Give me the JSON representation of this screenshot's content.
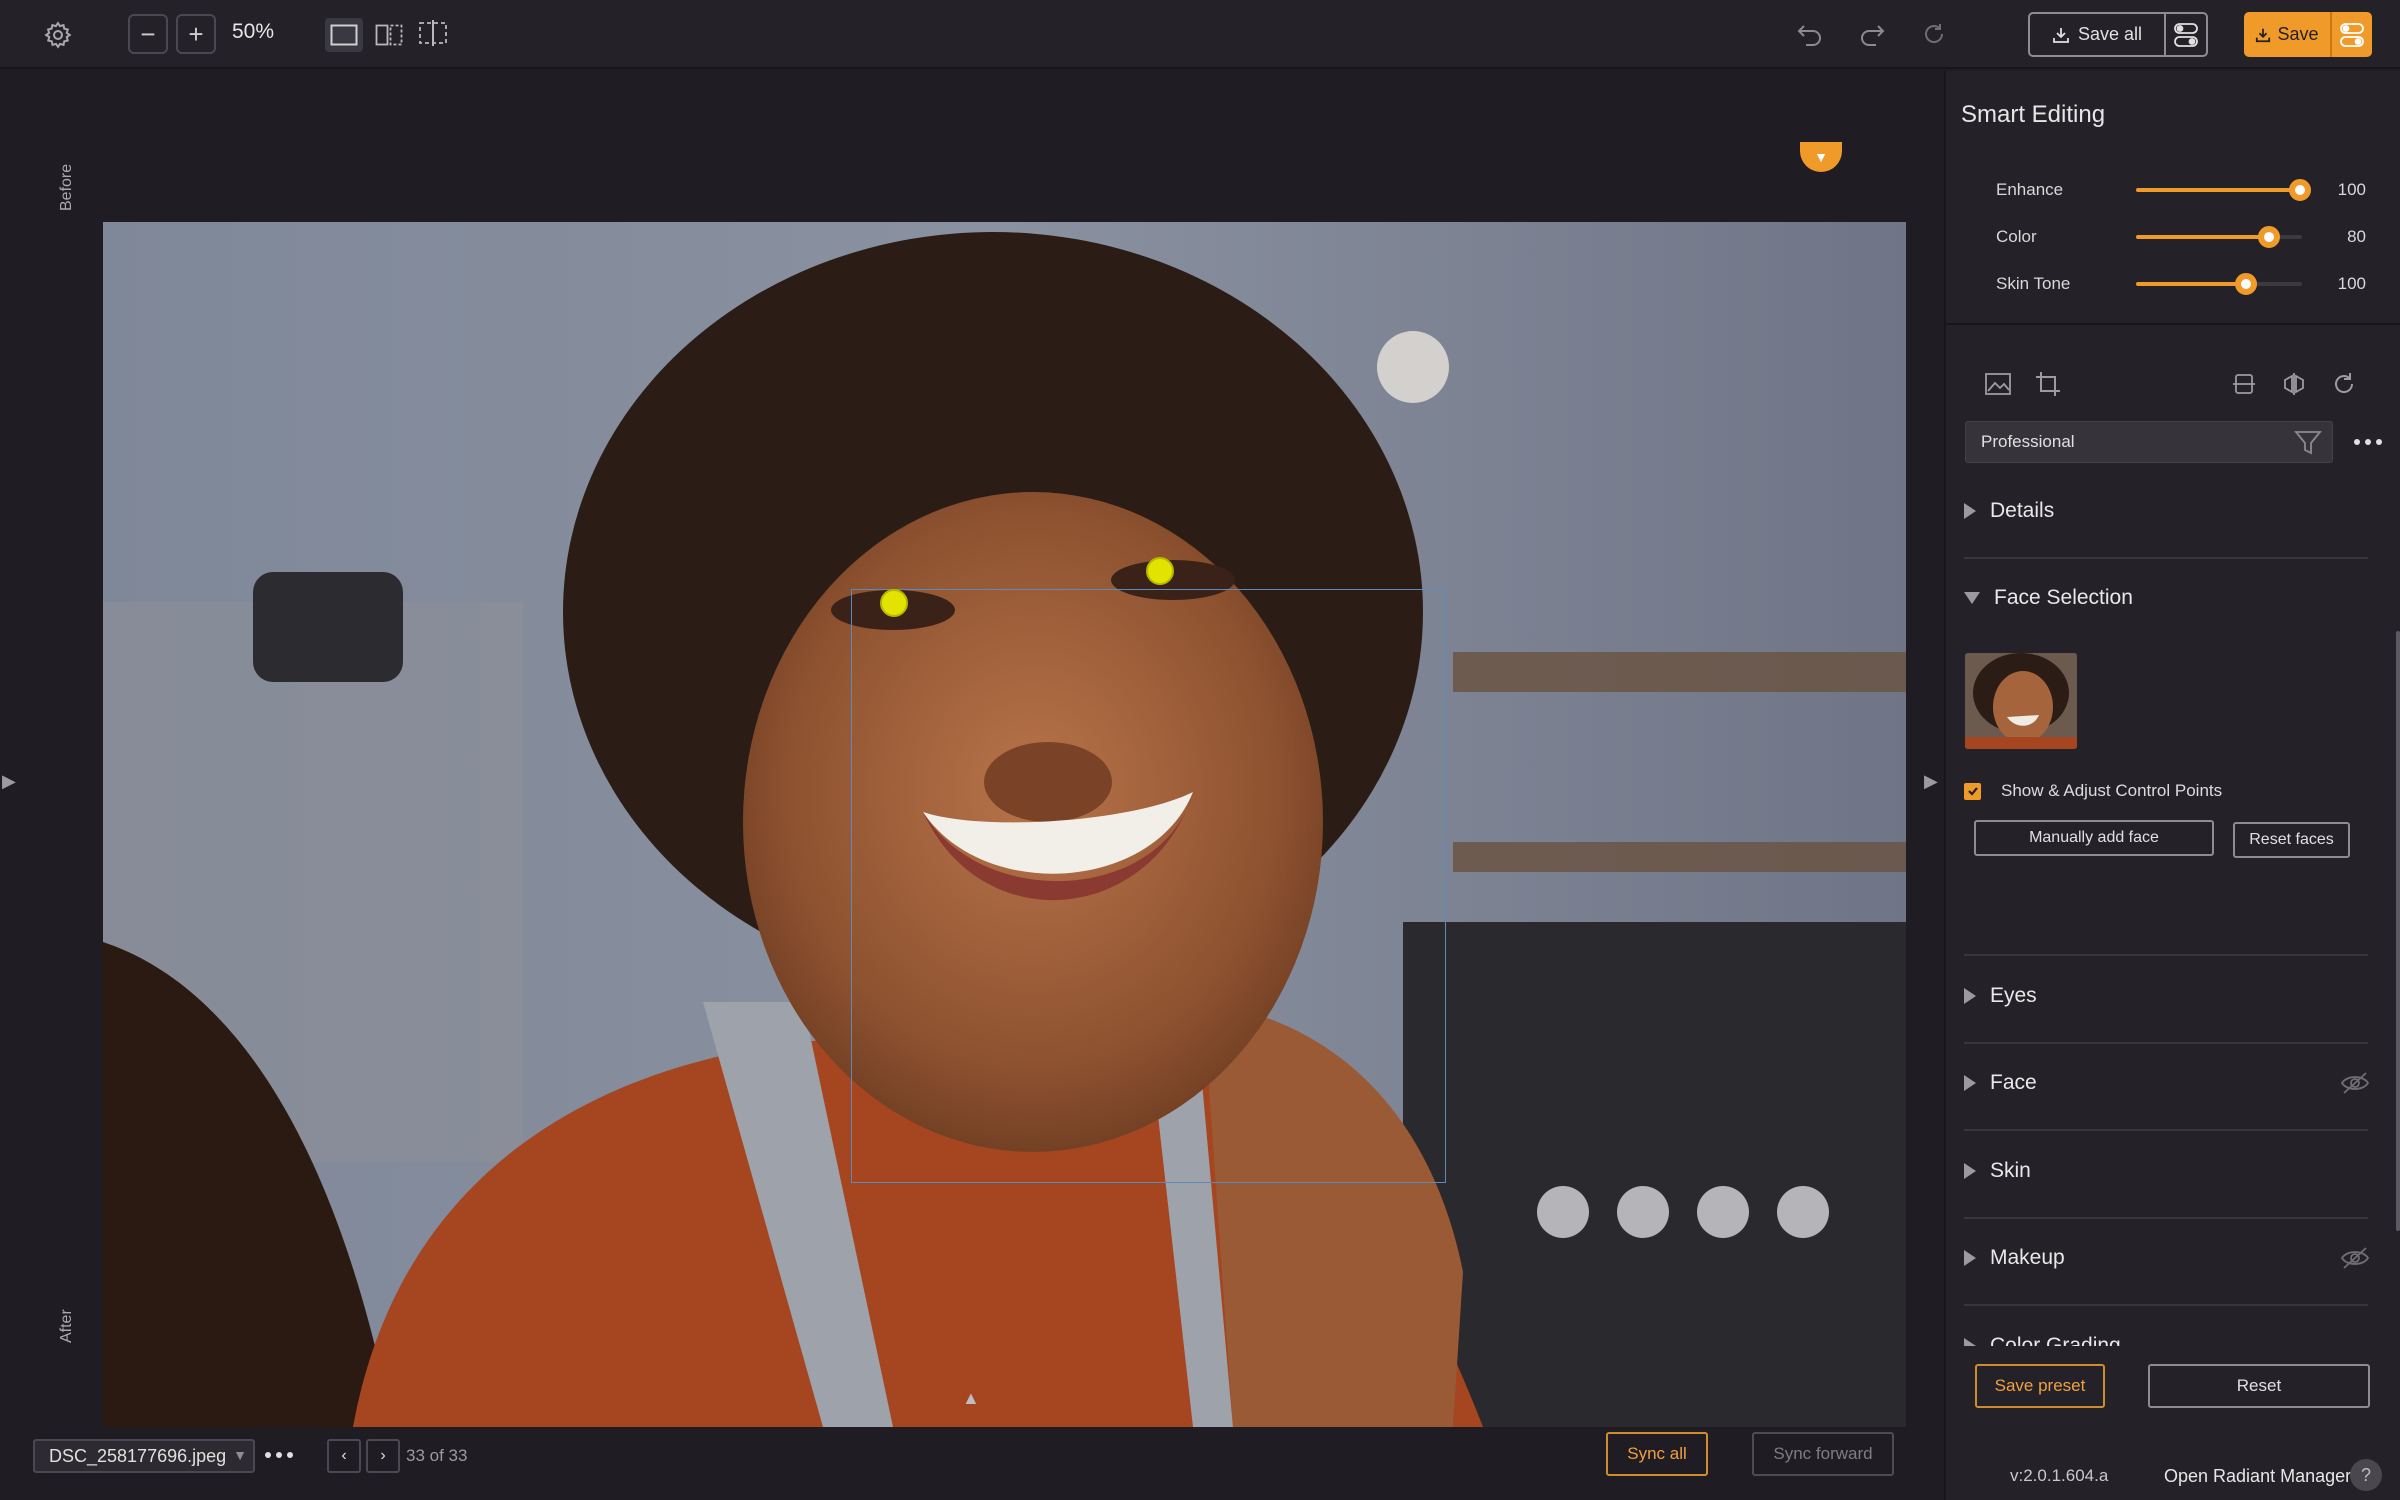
{
  "toolbar": {
    "zoom_out_label": "−",
    "zoom_in_label": "+",
    "zoom_value": "50%",
    "save_all_label": "Save all",
    "save_label": "Save"
  },
  "canvas": {
    "before_label": "Before",
    "after_label": "After"
  },
  "bottombar": {
    "file_name": "DSC_258177696.jpeg",
    "counter": "33 of 33",
    "sync_all_label": "Sync all",
    "sync_forward_label": "Sync forward"
  },
  "panel": {
    "title": "Smart Editing",
    "sliders": [
      {
        "label": "Enhance",
        "value": "100",
        "level": 0.99
      },
      {
        "label": "Color",
        "value": "80",
        "level": 0.8
      },
      {
        "label": "Skin Tone",
        "value": "100",
        "level": 0.66
      }
    ],
    "preset_value": "Professional",
    "sections": {
      "details": "Details",
      "face_selection": "Face Selection",
      "eyes": "Eyes",
      "face": "Face",
      "skin": "Skin",
      "makeup": "Makeup",
      "color_grading": "Color Grading"
    },
    "show_control_points_label": "Show & Adjust Control Points",
    "show_control_points_checked": true,
    "manually_add_face_label": "Manually add face",
    "reset_faces_label": "Reset faces",
    "save_preset_label": "Save preset",
    "reset_label": "Reset",
    "version": "v:2.0.1.604.a",
    "manager_label": "Open Radiant Manager",
    "help_label": "?"
  },
  "colors": {
    "accent": "#f09a2a",
    "background": "#1f1d23",
    "panel": "#242228",
    "control_point": "#e3e300",
    "face_box": "#5f89b8"
  },
  "icons": [
    "gear-icon",
    "undo-icon",
    "redo-icon",
    "refresh-icon",
    "download-icon",
    "toggle-icon",
    "image-icon",
    "crop-icon",
    "straighten-icon",
    "flip-icon",
    "rotate-icon",
    "filter-icon",
    "eye-off-icon",
    "help-icon"
  ]
}
